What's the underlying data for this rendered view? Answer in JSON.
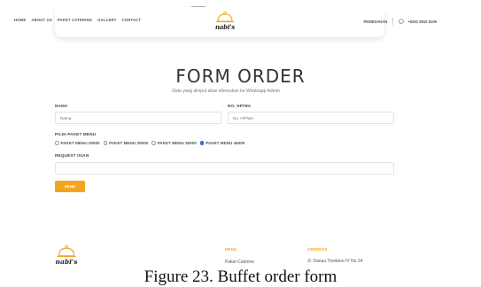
{
  "header": {
    "nav": [
      "HOME",
      "ABOUT US",
      "PAKET CATERING",
      "GALLERY",
      "CONTACT"
    ],
    "logo_text": "nabi's",
    "order_link": "PEMESANAN",
    "phone": "+6281 9910 8109",
    "whatsapp_icon": "whatsapp-icon"
  },
  "form": {
    "title": "FORM ORDER",
    "subtitle": "Data yang diinput akan diteruskan ke Whatsapp Admin",
    "name_label": "NAMA",
    "name_placeholder": "Nama",
    "phone_label": "NO. HP/WA",
    "phone_placeholder": "No. HP/WA",
    "package_label": "PILIH PAKET MENU",
    "packages": [
      {
        "label": "PAKET MENU 25000",
        "selected": false
      },
      {
        "label": "PAKET MENU 30000",
        "selected": false
      },
      {
        "label": "PAKET MENU 35000",
        "selected": false
      },
      {
        "label": "PAKET MENU 45000",
        "selected": true
      }
    ],
    "request_label": "REQUEST ISIAN",
    "request_value": "",
    "send_label": "SEND",
    "accent_color": "#f2a41f"
  },
  "footer": {
    "logo_text": "nabi's",
    "menu_heading": "MENU",
    "menu_item": "Paket Caterine",
    "address_heading": "ADDRESS",
    "address_line": "Jl. Danau Tondano IV No 24"
  },
  "caption": "Figure 23. Buffet order form"
}
